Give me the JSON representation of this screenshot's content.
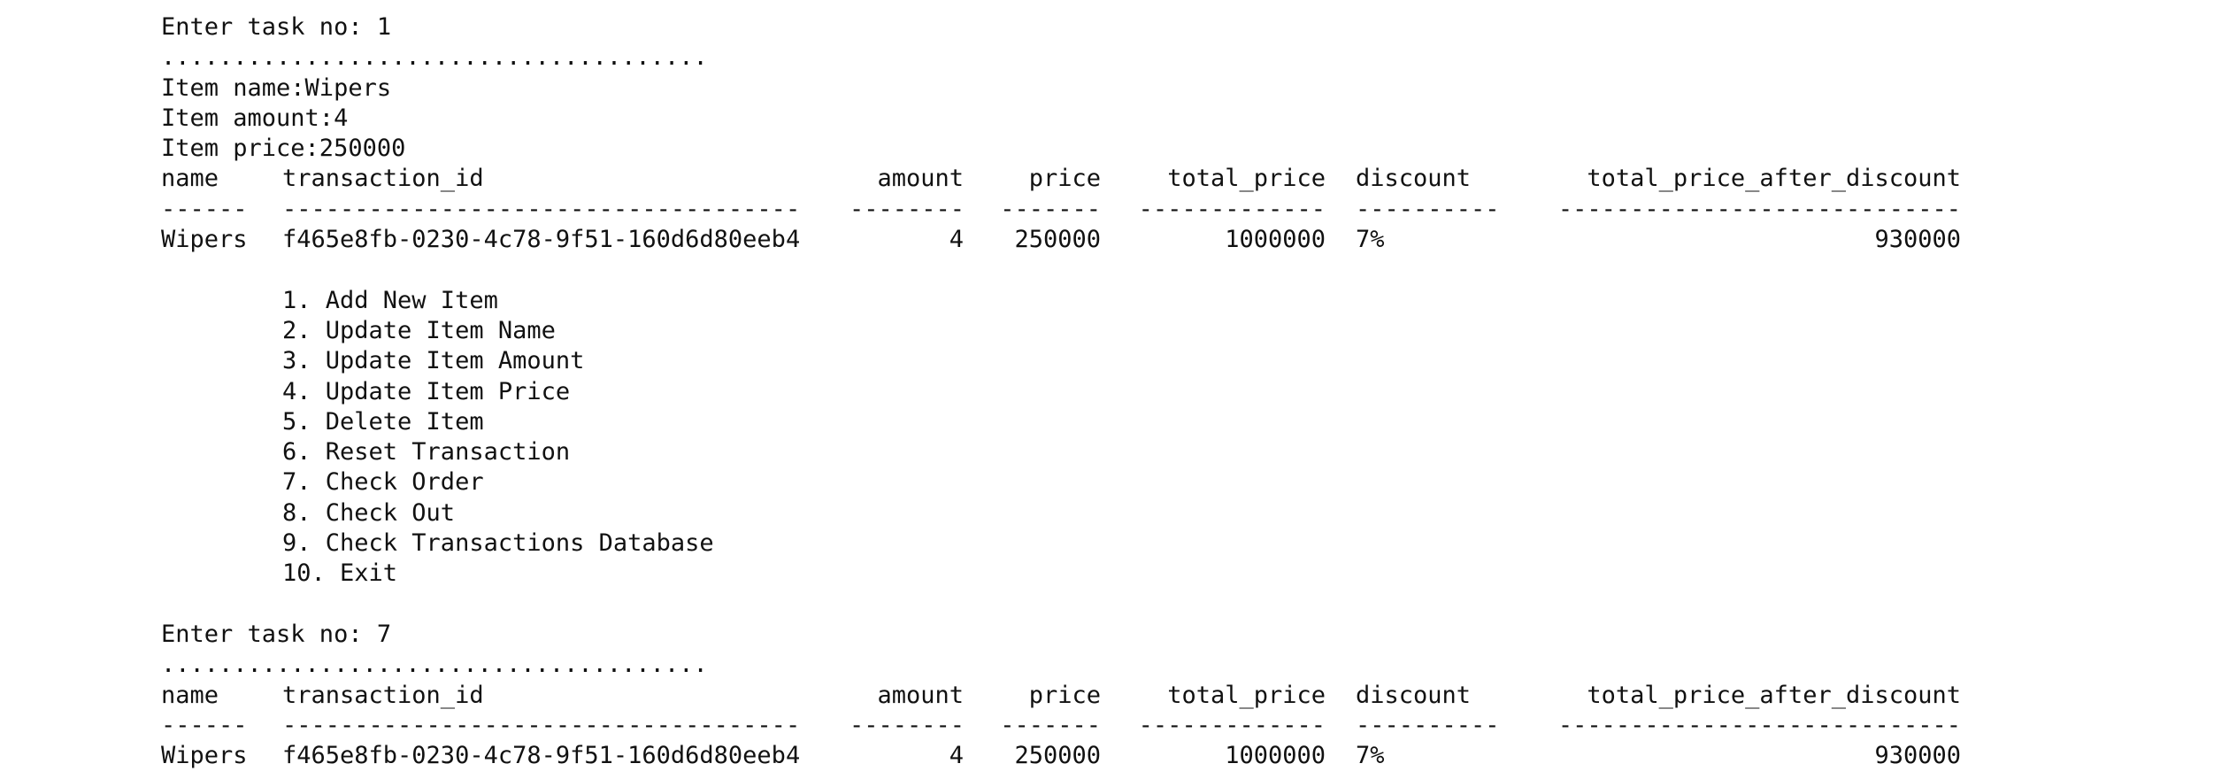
{
  "session": {
    "prompt1": "Enter task no: 1",
    "dots1": "......................................",
    "item_name": "Item name:Wipers",
    "item_amount": "Item amount:4",
    "item_price": "Item price:250000",
    "prompt2": "Enter task no: 7",
    "dots2": "......................................"
  },
  "table_headers": {
    "name": "name",
    "transaction_id": "transaction_id",
    "amount": "amount",
    "price": "price",
    "total_price": "total_price",
    "discount": "discount",
    "total_price_after_discount": "total_price_after_discount"
  },
  "table_dashes": {
    "name": "------",
    "transaction_id": "------------------------------------",
    "amount": "--------",
    "price": "-------",
    "total_price": "-------------",
    "discount": "----------",
    "total_price_after_discount": "----------------------------"
  },
  "table_row": {
    "name": "Wipers",
    "transaction_id": "f465e8fb-0230-4c78-9f51-160d6d80eeb4",
    "amount": "4",
    "price": "250000",
    "total_price": "1000000",
    "discount": "7%",
    "total_price_after_discount": "930000"
  },
  "menu": [
    "1. Add New Item",
    "2. Update Item Name",
    "3. Update Item Amount",
    "4. Update Item Price",
    "5. Delete Item",
    "6. Reset Transaction",
    "7. Check Order",
    "8. Check Out",
    "9. Check Transactions Database",
    "10. Exit"
  ]
}
